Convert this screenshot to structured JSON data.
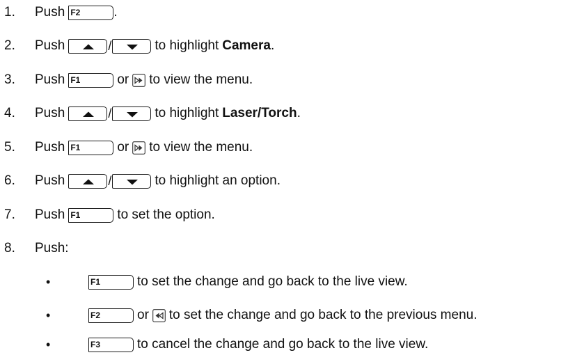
{
  "steps": [
    {
      "num": "1.",
      "pre": "Push",
      "key": "F2",
      "post": "."
    },
    {
      "num": "2.",
      "pre": "Push",
      "sep": "/",
      "post": "to highlight",
      "bold": "Camera",
      "end": "."
    },
    {
      "num": "3.",
      "pre": "Push",
      "key": "F1",
      "or": "or",
      "post": "to view the menu."
    },
    {
      "num": "4.",
      "pre": "Push",
      "sep": "/",
      "post": "to highlight",
      "bold": "Laser/Torch",
      "end": "."
    },
    {
      "num": "5.",
      "pre": "Push",
      "key": "F1",
      "or": "or",
      "post": "to view the menu."
    },
    {
      "num": "6.",
      "pre": "Push",
      "sep": "/",
      "post": "to highlight an option."
    },
    {
      "num": "7.",
      "pre": "Push",
      "key": "F1",
      "post": "to set the option."
    },
    {
      "num": "8.",
      "pre": "Push:"
    }
  ],
  "bullets": [
    {
      "symbol": "•",
      "key": "F1",
      "post": "to set the change and go back to the live view."
    },
    {
      "symbol": "•",
      "key": "F2",
      "or": "or",
      "post": "to set the change and go back to the previous menu."
    },
    {
      "symbol": "•",
      "key": "F3",
      "post": "to cancel the change and go back to the live view."
    }
  ],
  "icons": {
    "up": "up-arrow-key-icon",
    "down": "down-arrow-key-icon",
    "forward": "forward-nav-icon",
    "back": "back-nav-icon"
  }
}
